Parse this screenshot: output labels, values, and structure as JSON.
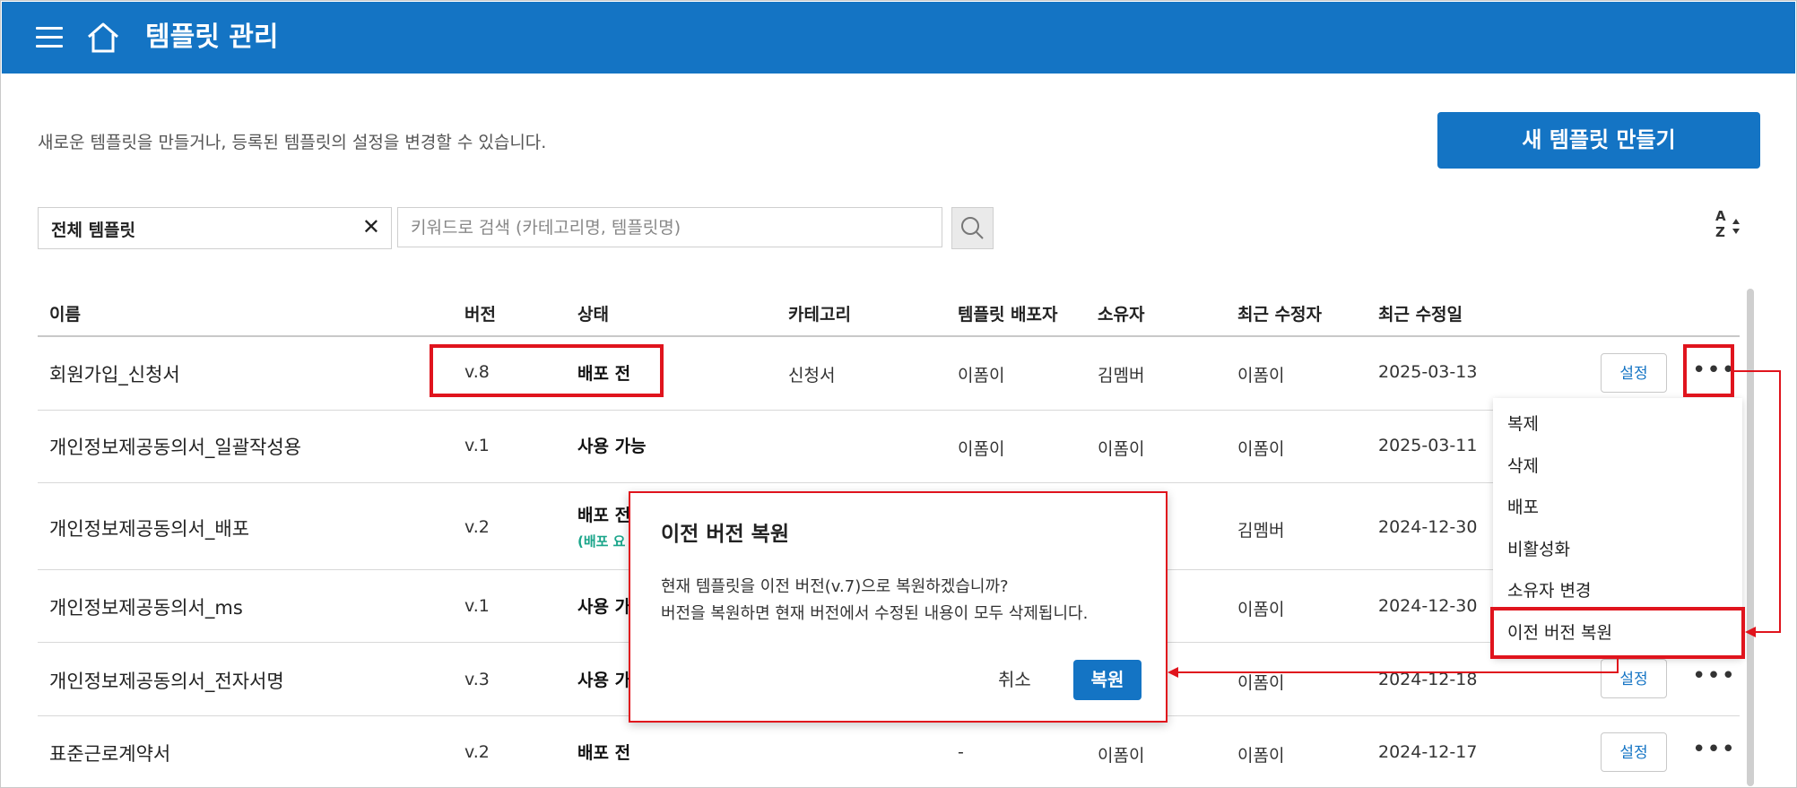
{
  "app": {
    "title": "템플릿 관리",
    "description": "새로운 템플릿을 만들거나, 등록된 템플릿의 설정을 변경할 수 있습니다.",
    "new_button": "새 템플릿 만들기"
  },
  "filter": {
    "value": "전체 템플릿",
    "clear": "✕"
  },
  "search": {
    "placeholder": "키워드로 검색 (카테고리명, 템플릿명)"
  },
  "sort": {
    "top": "A",
    "bottom": "Z"
  },
  "table": {
    "headers": [
      "이름",
      "버전",
      "상태",
      "카테고리",
      "템플릿 배포자",
      "소유자",
      "최근 수정자",
      "최근 수정일"
    ],
    "settings_label": "설정",
    "more_label": "•••",
    "rows": [
      {
        "name": "회원가입_신청서",
        "version": "v.8",
        "status": "배포 전",
        "status_note": "",
        "category": "신청서",
        "deployer": "이폼이",
        "owner": "김멤버",
        "modifier": "이폼이",
        "date": "2025-03-13"
      },
      {
        "name": "개인정보제공동의서_일괄작성용",
        "version": "v.1",
        "status": "사용 가능",
        "status_note": "",
        "category": "",
        "deployer": "이폼이",
        "owner": "이폼이",
        "modifier": "이폼이",
        "date": "2025-03-11"
      },
      {
        "name": "개인정보제공동의서_배포",
        "version": "v.2",
        "status": "배포 전",
        "status_note": "(배포 요",
        "category": "",
        "deployer": "",
        "owner": "",
        "modifier": "김멤버",
        "date": "2024-12-30"
      },
      {
        "name": "개인정보제공동의서_ms",
        "version": "v.1",
        "status": "사용 가",
        "status_note": "",
        "category": "",
        "deployer": "",
        "owner": "",
        "modifier": "이폼이",
        "date": "2024-12-30"
      },
      {
        "name": "개인정보제공동의서_전자서명",
        "version": "v.3",
        "status": "사용 가",
        "status_note": "",
        "category": "",
        "deployer": "",
        "owner": "",
        "modifier": "이폼이",
        "date": "2024-12-18"
      },
      {
        "name": "표준근로계약서",
        "version": "v.2",
        "status": "배포 전",
        "status_note": "",
        "category": "",
        "deployer": "-",
        "owner": "이폼이",
        "modifier": "이폼이",
        "date": "2024-12-17"
      }
    ]
  },
  "context_menu": {
    "items": [
      "복제",
      "삭제",
      "배포",
      "비활성화",
      "소유자 변경",
      "이전 버전 복원"
    ]
  },
  "dialog": {
    "title": "이전 버전 복원",
    "message_line1": "현재 템플릿을 이전 버전(v.7)으로 복원하겠습니까?",
    "message_line2": "버전을 복원하면 현재 버전에서 수정된 내용이 모두 삭제됩니다.",
    "cancel": "취소",
    "confirm": "복원"
  },
  "colors": {
    "primary": "#1474c4",
    "highlight": "#e0141d",
    "status_note": "#1aa58a"
  }
}
